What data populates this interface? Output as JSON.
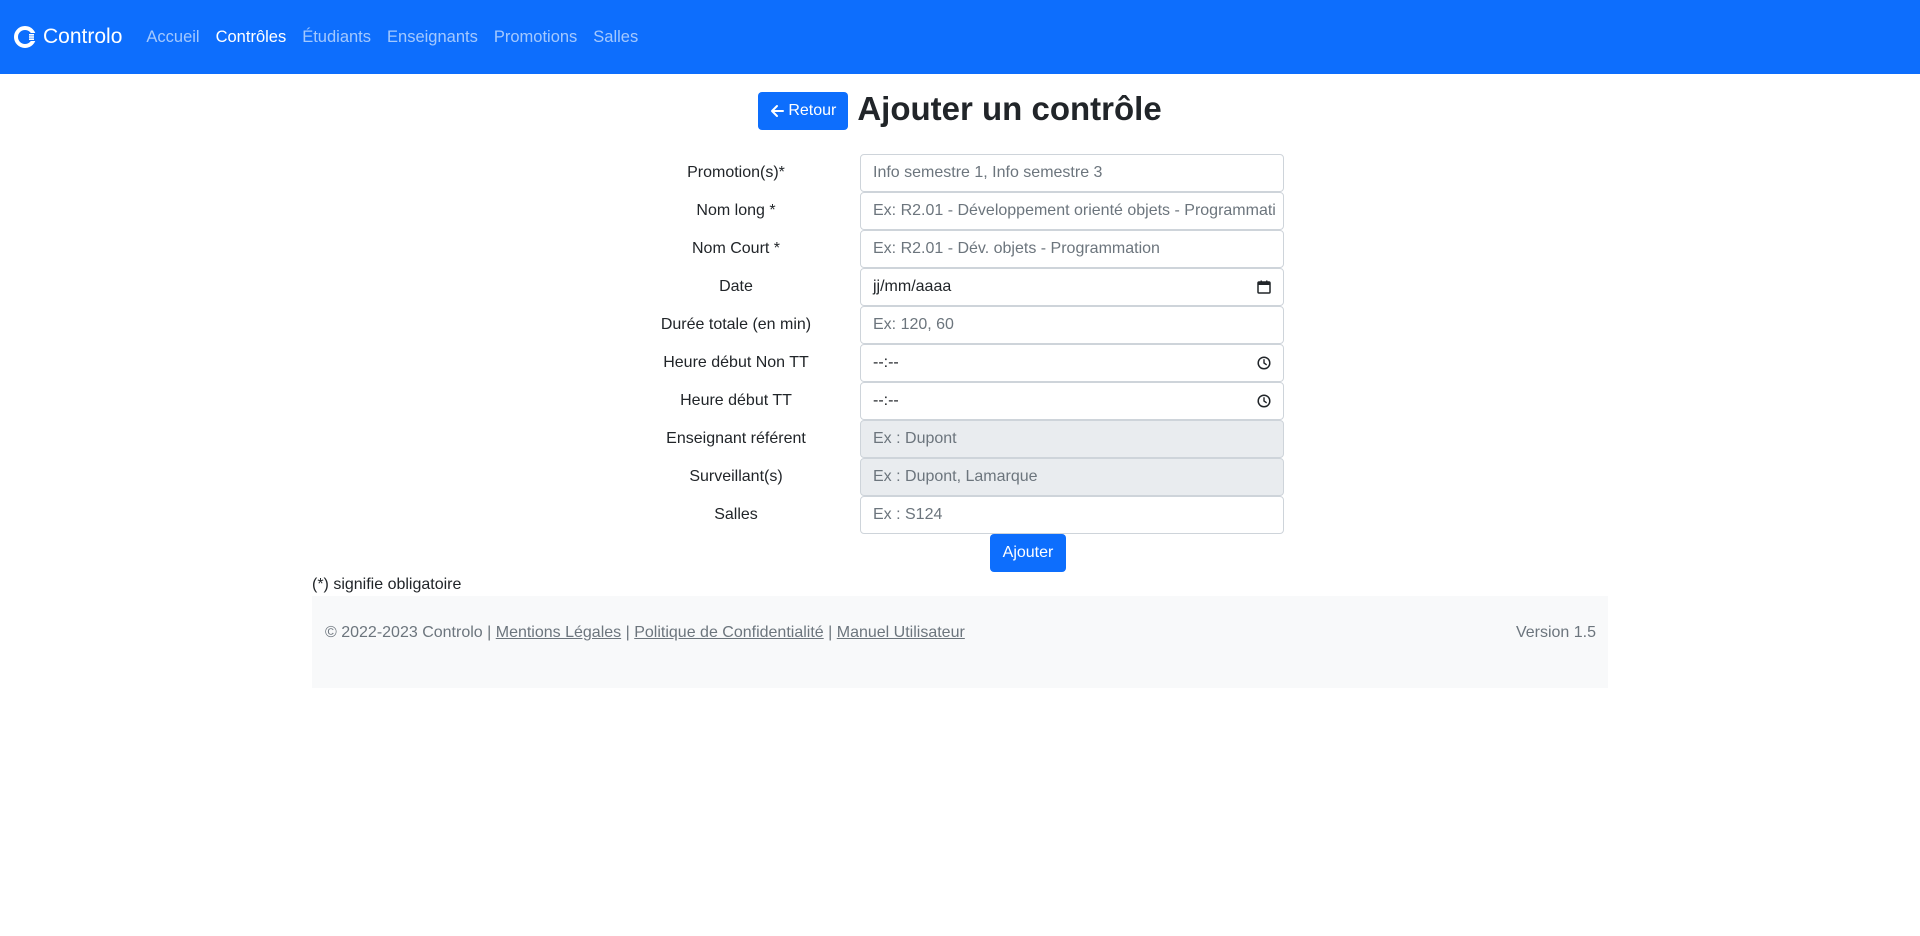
{
  "nav": {
    "brand": "Controlo",
    "links": [
      "Accueil",
      "Contrôles",
      "Étudiants",
      "Enseignants",
      "Promotions",
      "Salles"
    ],
    "active": "Contrôles"
  },
  "page": {
    "back_label": "Retour",
    "title": "Ajouter un contrôle"
  },
  "form": {
    "promotions": {
      "label": "Promotion(s)*",
      "placeholder": "Info semestre 1, Info semestre 3"
    },
    "nom_long": {
      "label": "Nom long *",
      "placeholder": "Ex: R2.01 - Développement orienté objets - Programmati"
    },
    "nom_court": {
      "label": "Nom Court *",
      "placeholder": "Ex: R2.01 - Dév. objets - Programmation"
    },
    "date": {
      "label": "Date",
      "value": "jj/mm/aaaa"
    },
    "duree": {
      "label": "Durée totale (en min)",
      "placeholder": "Ex: 120, 60"
    },
    "heure_non_tt": {
      "label": "Heure début Non TT",
      "value": "--:--"
    },
    "heure_tt": {
      "label": "Heure début TT",
      "value": "--:--"
    },
    "enseignant": {
      "label": "Enseignant référent",
      "placeholder": "Ex : Dupont"
    },
    "surveillants": {
      "label": "Surveillant(s)",
      "placeholder": "Ex : Dupont, Lamarque"
    },
    "salles": {
      "label": "Salles",
      "placeholder": "Ex : S124"
    },
    "submit_label": "Ajouter"
  },
  "note": "(*) signifie obligatoire",
  "footer": {
    "copyright": "© 2022-2023 Controlo |",
    "mentions": "Mentions Légales",
    "sep1": "|",
    "politique": "Politique de Confidentialité",
    "sep2": "|",
    "manuel": "Manuel Utilisateur",
    "version": "Version 1.5"
  },
  "colors": {
    "primary": "#0d6efd",
    "disabled_bg": "#e9ecef",
    "footer_bg": "#f8f9fa"
  }
}
